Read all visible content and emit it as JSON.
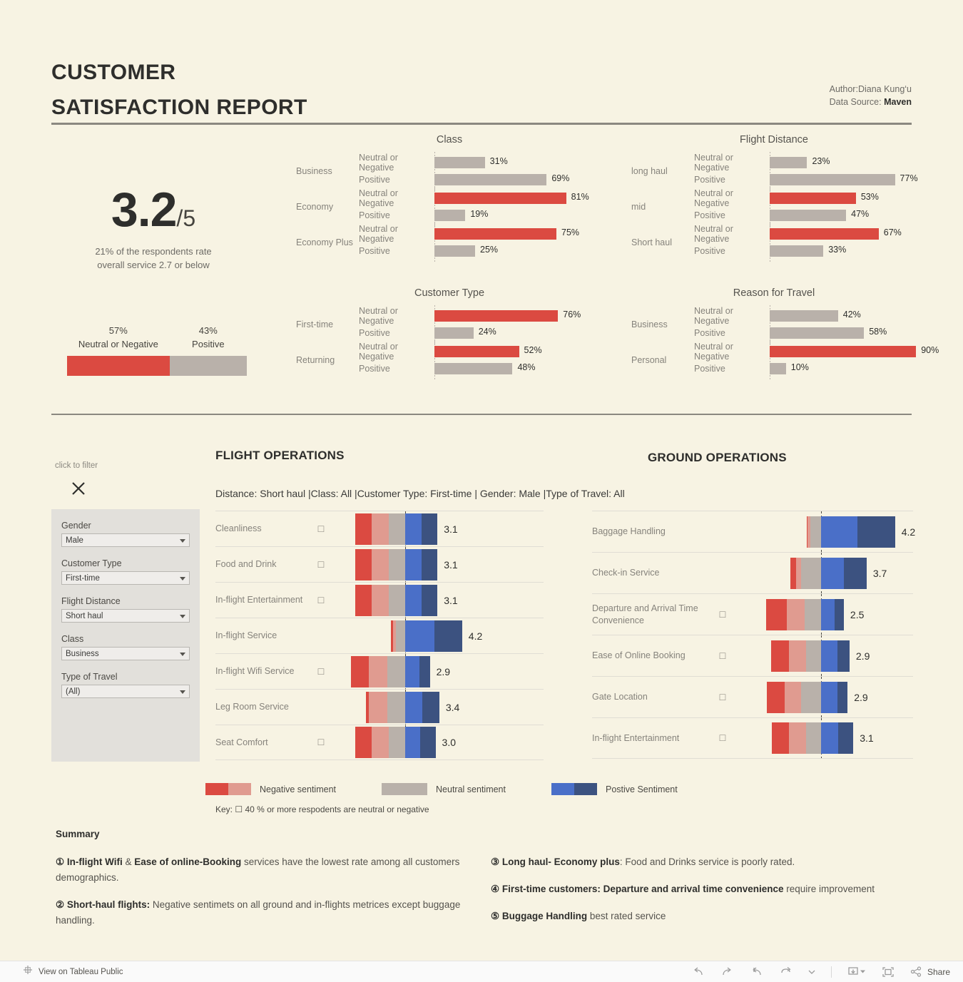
{
  "header": {
    "title_line1": "CUSTOMER",
    "title_line2": "SATISFACTION REPORT",
    "author_label": "Author:Diana Kung‘u",
    "source_label": "Data Source:",
    "source_value": "Maven"
  },
  "kpi": {
    "score": "3.2",
    "denominator": "/5",
    "subtext_line1": "21% of the respondents rate",
    "subtext_line2": "overall service  2.7 or below",
    "split": {
      "negative_pct": "57%",
      "negative_label": "Neutral or Negative",
      "positive_pct": "43%",
      "positive_label": "Positive",
      "negative_value": 57,
      "positive_value": 43
    }
  },
  "colors": {
    "background": "#f7f3e3",
    "red": "#db4a41",
    "salmon": "#e09b90",
    "neutral": "#b9b1aa",
    "blue": "#4a6fc8",
    "navy": "#3c5280"
  },
  "chart_data": [
    {
      "type": "bar",
      "title": "Class",
      "xlabel": "",
      "ylabel": "",
      "xlim": [
        0,
        100
      ],
      "unit": "%",
      "groups": [
        {
          "category": "Business",
          "rows": [
            {
              "label": "Neutral or Negative",
              "value": 31,
              "display": "31%",
              "color": "neutral"
            },
            {
              "label": "Positive",
              "value": 69,
              "display": "69%",
              "color": "neutral"
            }
          ]
        },
        {
          "category": "Economy",
          "rows": [
            {
              "label": "Neutral or Negative",
              "value": 81,
              "display": "81%",
              "color": "red"
            },
            {
              "label": "Positive",
              "value": 19,
              "display": "19%",
              "color": "neutral"
            }
          ]
        },
        {
          "category": "Economy Plus",
          "rows": [
            {
              "label": "Neutral or Negative",
              "value": 75,
              "display": "75%",
              "color": "red"
            },
            {
              "label": "Positive",
              "value": 25,
              "display": "25%",
              "color": "neutral"
            }
          ]
        }
      ]
    },
    {
      "type": "bar",
      "title": "Flight Distance",
      "xlabel": "",
      "ylabel": "",
      "xlim": [
        0,
        100
      ],
      "unit": "%",
      "groups": [
        {
          "category": "long haul",
          "rows": [
            {
              "label": "Neutral or Negative",
              "value": 23,
              "display": "23%",
              "color": "neutral"
            },
            {
              "label": "Positive",
              "value": 77,
              "display": "77%",
              "color": "neutral"
            }
          ]
        },
        {
          "category": "mid",
          "rows": [
            {
              "label": "Neutral or Negative",
              "value": 53,
              "display": "53%",
              "color": "red"
            },
            {
              "label": "Positive",
              "value": 47,
              "display": "47%",
              "color": "neutral"
            }
          ]
        },
        {
          "category": "Short haul",
          "rows": [
            {
              "label": "Neutral or Negative",
              "value": 67,
              "display": "67%",
              "color": "red"
            },
            {
              "label": "Positive",
              "value": 33,
              "display": "33%",
              "color": "neutral"
            }
          ]
        }
      ]
    },
    {
      "type": "bar",
      "title": "Customer Type",
      "xlabel": "",
      "ylabel": "",
      "xlim": [
        0,
        100
      ],
      "unit": "%",
      "groups": [
        {
          "category": "First-time",
          "rows": [
            {
              "label": "Neutral or Negative",
              "value": 76,
              "display": "76%",
              "color": "red"
            },
            {
              "label": "Positive",
              "value": 24,
              "display": "24%",
              "color": "neutral"
            }
          ]
        },
        {
          "category": "Returning",
          "rows": [
            {
              "label": "Neutral or Negative",
              "value": 52,
              "display": "52%",
              "color": "red"
            },
            {
              "label": "Positive",
              "value": 48,
              "display": "48%",
              "color": "neutral"
            }
          ]
        }
      ]
    },
    {
      "type": "bar",
      "title": "Reason for Travel",
      "xlabel": "",
      "ylabel": "",
      "xlim": [
        0,
        100
      ],
      "unit": "%",
      "groups": [
        {
          "category": "Business",
          "rows": [
            {
              "label": "Neutral or Negative",
              "value": 42,
              "display": "42%",
              "color": "neutral"
            },
            {
              "label": "Positive",
              "value": 58,
              "display": "58%",
              "color": "neutral"
            }
          ]
        },
        {
          "category": "Personal",
          "rows": [
            {
              "label": "Neutral or Negative",
              "value": 90,
              "display": "90%",
              "color": "red"
            },
            {
              "label": "Positive",
              "value": 10,
              "display": "10%",
              "color": "neutral"
            }
          ]
        }
      ]
    },
    {
      "type": "bar",
      "title": "FLIGHT OPERATIONS",
      "subtitle": "Distance: Short haul |Class: All |Customer Type: First-time | Gender: Male |Type of Travel: All",
      "stacked": true,
      "series": [
        "Negative strong",
        "Negative mild",
        "Neutral",
        "Positive mild",
        "Positive strong"
      ],
      "rows": [
        {
          "label": "Cleanliness",
          "score": "3.1",
          "flagged": true,
          "segments": [
            18,
            18,
            17,
            17,
            17
          ],
          "offset": -53
        },
        {
          "label": "Food and Drink",
          "score": "3.1",
          "flagged": true,
          "segments": [
            18,
            18,
            17,
            17,
            17
          ],
          "offset": -53
        },
        {
          "label": "In-flight Entertainment",
          "score": "3.1",
          "flagged": true,
          "segments": [
            18,
            18,
            17,
            17,
            17
          ],
          "offset": -53
        },
        {
          "label": "In-flight Service",
          "score": "4.2",
          "flagged": false,
          "segments": [
            2,
            3,
            10,
            31,
            29
          ],
          "offset": -15
        },
        {
          "label": "In-flight Wifi Service",
          "score": "2.9",
          "flagged": true,
          "segments": [
            19,
            19,
            19,
            15,
            11
          ],
          "offset": -57
        },
        {
          "label": "Leg Room Service",
          "score": "3.4",
          "flagged": false,
          "segments": [
            3,
            19,
            19,
            18,
            18
          ],
          "offset": -41
        },
        {
          "label": "Seat Comfort",
          "score": "3.0",
          "flagged": true,
          "segments": [
            18,
            18,
            17,
            16,
            16
          ],
          "offset": -53
        }
      ]
    },
    {
      "type": "bar",
      "title": "GROUND OPERATIONS",
      "stacked": true,
      "series": [
        "Negative strong",
        "Negative mild",
        "Neutral",
        "Positive mild",
        "Positive strong"
      ],
      "rows": [
        {
          "label": "Baggage Handling",
          "score": "4.2",
          "flagged": false,
          "segments": [
            1,
            3,
            11,
            38,
            40
          ],
          "offset": -15
        },
        {
          "label": "Check-in Service",
          "score": "3.7",
          "flagged": false,
          "segments": [
            6,
            5,
            21,
            24,
            24
          ],
          "offset": -32
        },
        {
          "label": "Departure and Arrival Time Convenience",
          "score": "2.5",
          "flagged": true,
          "segments": [
            22,
            19,
            17,
            14,
            10
          ],
          "offset": -58
        },
        {
          "label": "Ease of Online Booking",
          "score": "2.9",
          "flagged": true,
          "segments": [
            19,
            18,
            16,
            17,
            13
          ],
          "offset": -53
        },
        {
          "label": "Gate Location",
          "score": "2.9",
          "flagged": true,
          "segments": [
            19,
            17,
            21,
            17,
            11
          ],
          "offset": -57
        },
        {
          "label": "In-flight Entertainment",
          "score": "3.1",
          "flagged": true,
          "segments": [
            18,
            18,
            16,
            18,
            16
          ],
          "offset": -52
        }
      ]
    }
  ],
  "filters": {
    "hint": "click to filter",
    "items": [
      {
        "label": "Gender",
        "value": "Male"
      },
      {
        "label": "Customer Type",
        "value": "First-time"
      },
      {
        "label": "Flight Distance",
        "value": "Short haul"
      },
      {
        "label": "Class",
        "value": "Business"
      },
      {
        "label": "Type of Travel",
        "value": "(All)"
      }
    ]
  },
  "legend": {
    "items": [
      {
        "label": "Negative sentiment",
        "swatches": [
          "#db4a41",
          "#e09b90"
        ]
      },
      {
        "label": "Neutral sentiment",
        "swatches": [
          "#b9b1aa",
          "#b9b1aa"
        ]
      },
      {
        "label": "Postive Sentiment",
        "swatches": [
          "#4a6fc8",
          "#3c5280"
        ]
      }
    ],
    "key": "Key: ☐ 40 % or more respodents are neutral or negative"
  },
  "summary": {
    "title": "Summary",
    "left": [
      {
        "num": "①",
        "bold1": "In-flight Wifi",
        "mid": " & ",
        "bold2": "Ease of online-Booking",
        "rest": " services have the lowest rate among all customers demographics."
      },
      {
        "num": "②",
        "bold1": "Short-haul flights:",
        "mid": "",
        "bold2": "",
        "rest": " Negative sentimets on all ground and in-flights  metrices except buggage handling."
      }
    ],
    "right": [
      {
        "num": "③",
        "bold1": "Long haul- Economy plus",
        "mid": "",
        "bold2": "",
        "rest": ": Food and Drinks service is poorly rated."
      },
      {
        "num": "④",
        "bold1": "First-time customers: Departure and arrival time convenience",
        "mid": "",
        "bold2": "",
        "rest": " require improvement"
      },
      {
        "num": "⑤",
        "bold1": "Buggage Handling",
        "mid": "",
        "bold2": "",
        "rest": " best rated service"
      }
    ]
  },
  "toolbar": {
    "view_label": "View on Tableau Public",
    "share_label": "Share"
  }
}
